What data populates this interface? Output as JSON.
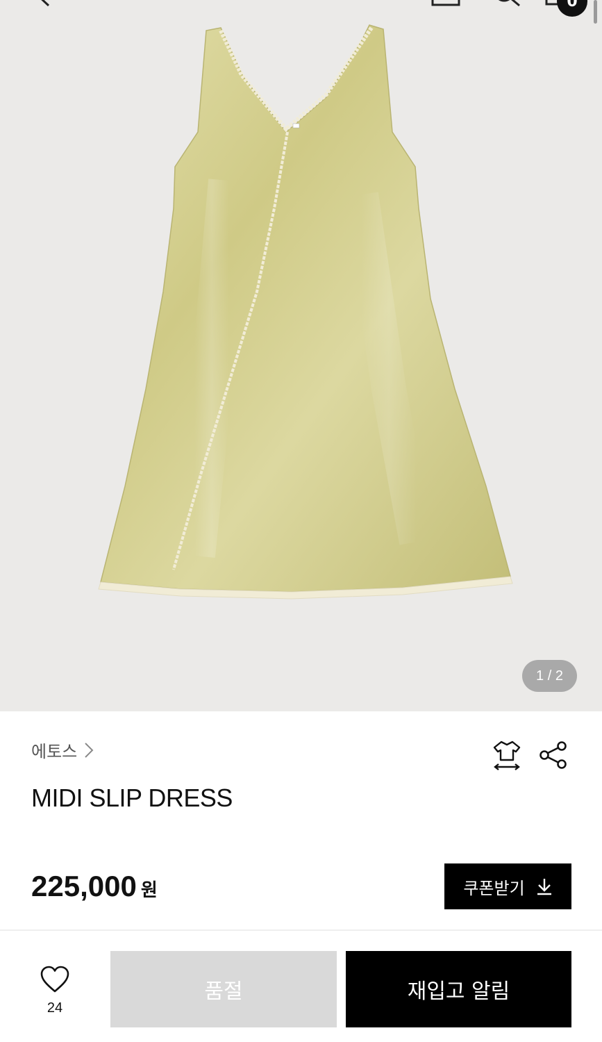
{
  "gallery": {
    "pager": "1 / 2",
    "image_alt": "MIDI SLIP DRESS product image"
  },
  "header": {
    "cart_count": "0"
  },
  "product": {
    "brand": "에토스",
    "title": "MIDI SLIP DRESS",
    "price": "225,000",
    "currency": "원"
  },
  "actions": {
    "coupon_label": "쿠폰받기",
    "like_count": "24",
    "soldout_label": "품절",
    "restock_label": "재입고 알림"
  },
  "colors": {
    "dress": "#d3cf8f",
    "lace": "#f1ecd6",
    "hero_bg": "#ebeae8"
  }
}
